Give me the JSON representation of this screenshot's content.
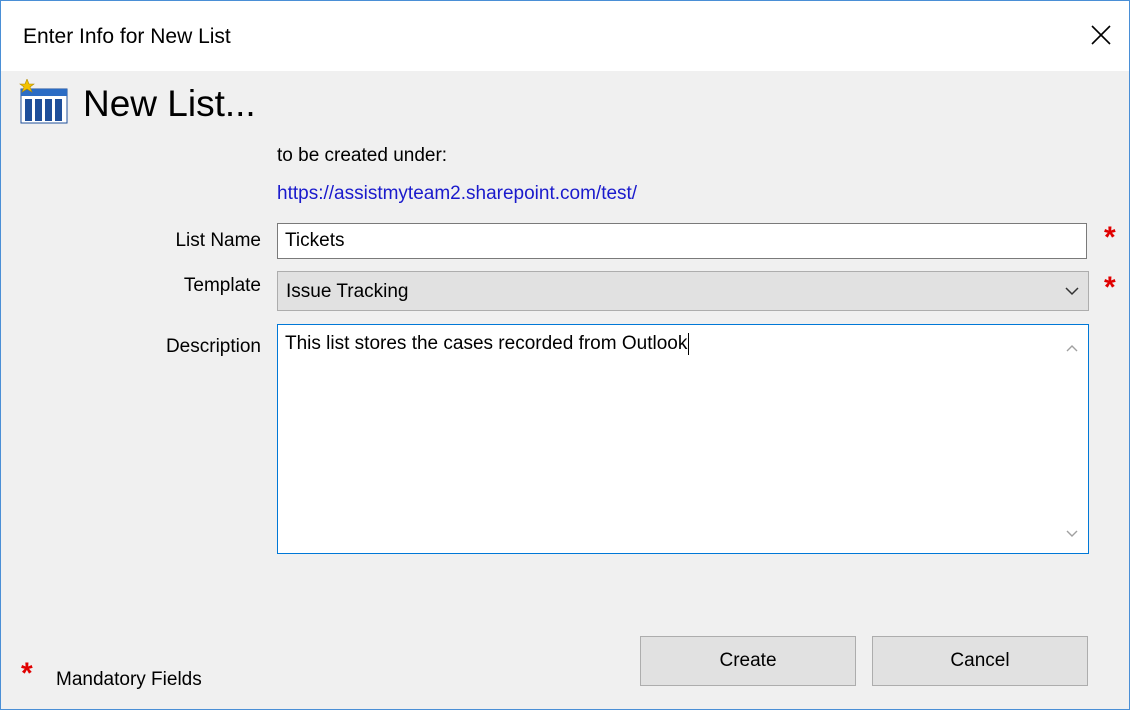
{
  "window": {
    "title": "Enter Info for New List",
    "accent_color": "#4a8fd6"
  },
  "header": {
    "icon": "sharepoint-list-icon",
    "title": "New List..."
  },
  "location": {
    "caption": "to be created under:",
    "url": "https://assistmyteam2.sharepoint.com/test/"
  },
  "form": {
    "list_name": {
      "label": "List Name",
      "value": "Tickets",
      "required": true
    },
    "template": {
      "label": "Template",
      "selected": "Issue Tracking",
      "required": true
    },
    "description": {
      "label": "Description",
      "value": "This list stores the cases recorded from Outlook"
    }
  },
  "legend": {
    "asterisk": "*",
    "text": "Mandatory Fields",
    "color": "#e00000"
  },
  "buttons": {
    "create_label": "Create",
    "cancel_label": "Cancel"
  }
}
